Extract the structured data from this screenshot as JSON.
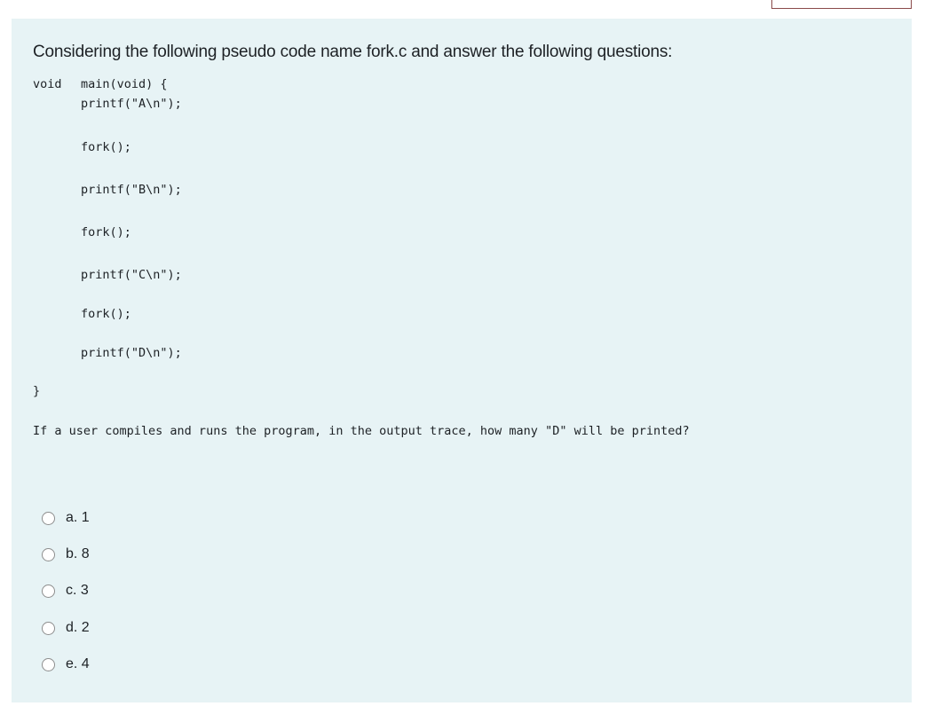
{
  "question": {
    "intro": "Considering the following pseudo code name fork.c and answer the following questions:",
    "code": {
      "line_void": "void",
      "line_main": "main(void) {",
      "lines": [
        "printf(\"A\\n\");",
        "fork();",
        "printf(\"B\\n\");",
        "fork();",
        "printf(\"C\\n\");",
        "fork();",
        "printf(\"D\\n\");"
      ],
      "closing": "}"
    },
    "prompt": "If a user compiles and runs the program, in the output trace, how many \"D\" will be printed?"
  },
  "options": [
    {
      "label": "a. 1",
      "selected": false
    },
    {
      "label": "b. 8",
      "selected": false
    },
    {
      "label": "c. 3",
      "selected": false
    },
    {
      "label": "d. 2",
      "selected": false
    },
    {
      "label": "e. 4",
      "selected": false
    }
  ]
}
